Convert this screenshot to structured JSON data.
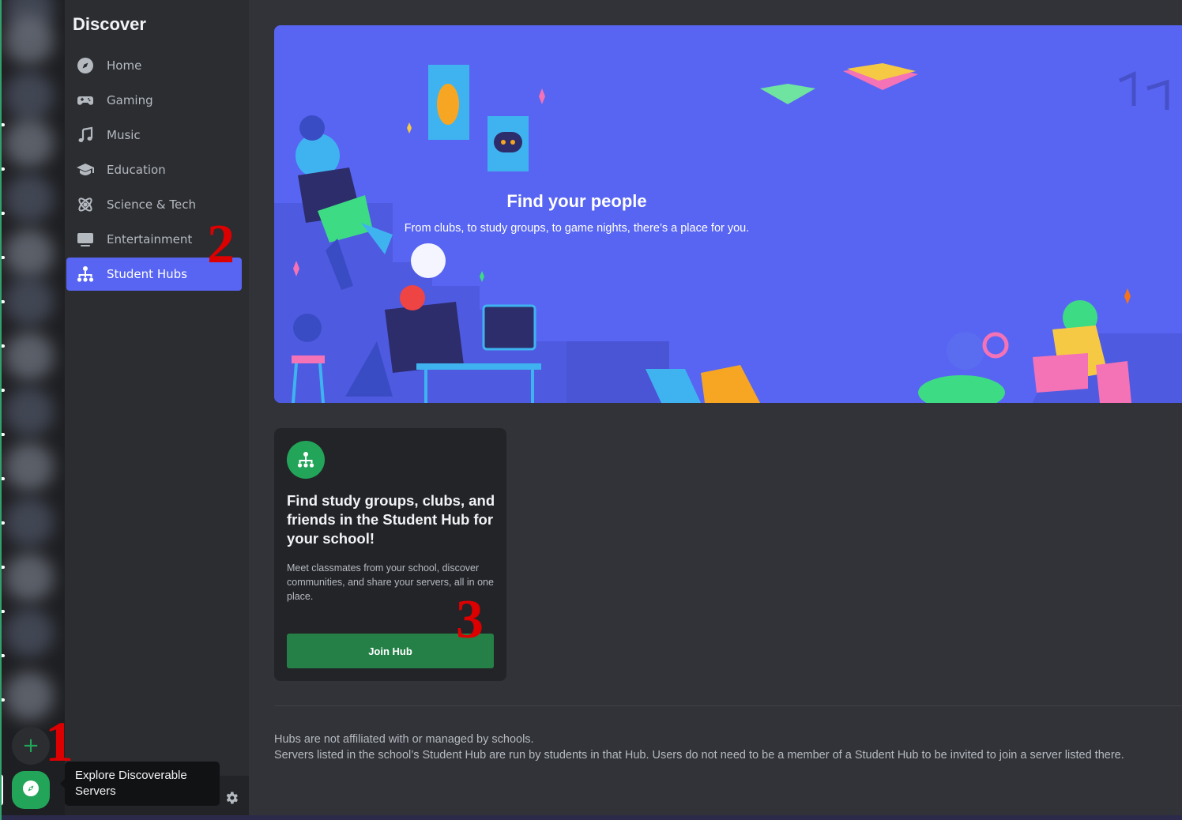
{
  "sidebar": {
    "title": "Discover",
    "items": [
      {
        "label": "Home",
        "icon": "compass-icon"
      },
      {
        "label": "Gaming",
        "icon": "gamepad-icon"
      },
      {
        "label": "Music",
        "icon": "music-note-icon"
      },
      {
        "label": "Education",
        "icon": "graduation-cap-icon"
      },
      {
        "label": "Science & Tech",
        "icon": "atom-icon"
      },
      {
        "label": "Entertainment",
        "icon": "tv-icon"
      },
      {
        "label": "Student Hubs",
        "icon": "hub-icon",
        "active": true
      }
    ]
  },
  "rail": {
    "add_server_glyph": "+",
    "explore_tooltip": "Explore Discoverable Servers"
  },
  "banner": {
    "title": "Find your people",
    "subtitle": "From clubs, to study groups, to game nights, there’s a place for you."
  },
  "hub_card": {
    "title": "Find study groups, clubs, and friends in the Student Hub for your school!",
    "description": "Meet classmates from your school, discover communities, and share your servers, all in one place.",
    "button_label": "Join Hub"
  },
  "footnote": {
    "line1": "Hubs are not affiliated with or managed by schools.",
    "line2": "Servers listed in the school’s Student Hub are run by students in that Hub. Users do not need to be a member of a Student Hub to be invited to join a server listed there."
  },
  "annotations": {
    "step1": "1",
    "step2": "2",
    "step3": "3"
  },
  "colors": {
    "accent": "#5865f2",
    "green": "#23a559",
    "join_button": "#248046",
    "annotation_red": "#dd0000"
  }
}
